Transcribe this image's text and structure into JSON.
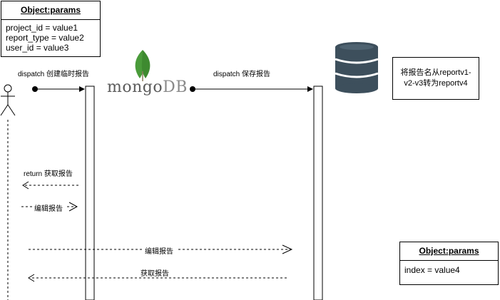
{
  "object_params_top": {
    "title": "Object:params",
    "lines": [
      "project_id = value1",
      "report_type = value2",
      "user_id = value3"
    ]
  },
  "object_params_bottom": {
    "title": "Object:params",
    "lines": [
      "index = value4"
    ]
  },
  "note": {
    "line1": "将报告名从reportv1-",
    "line2": "v2-v3转为reportv4"
  },
  "logo": {
    "mongo": "mongo",
    "db": "DB"
  },
  "messages": {
    "dispatch_create": "dispatch 创建临时报告",
    "dispatch_save": "dispatch 保存报告",
    "return_get": "return 获取报告",
    "edit_report_1": "编辑报告",
    "edit_report_2": "编辑报告",
    "get_report": "获取报告"
  },
  "icons": {
    "actor": "actor-icon",
    "database": "database-icon",
    "mongodb_leaf": "mongodb-leaf-icon"
  },
  "colors": {
    "database": "#3d4f5c",
    "leaf_green": "#4a9b3a",
    "line": "#000000"
  }
}
